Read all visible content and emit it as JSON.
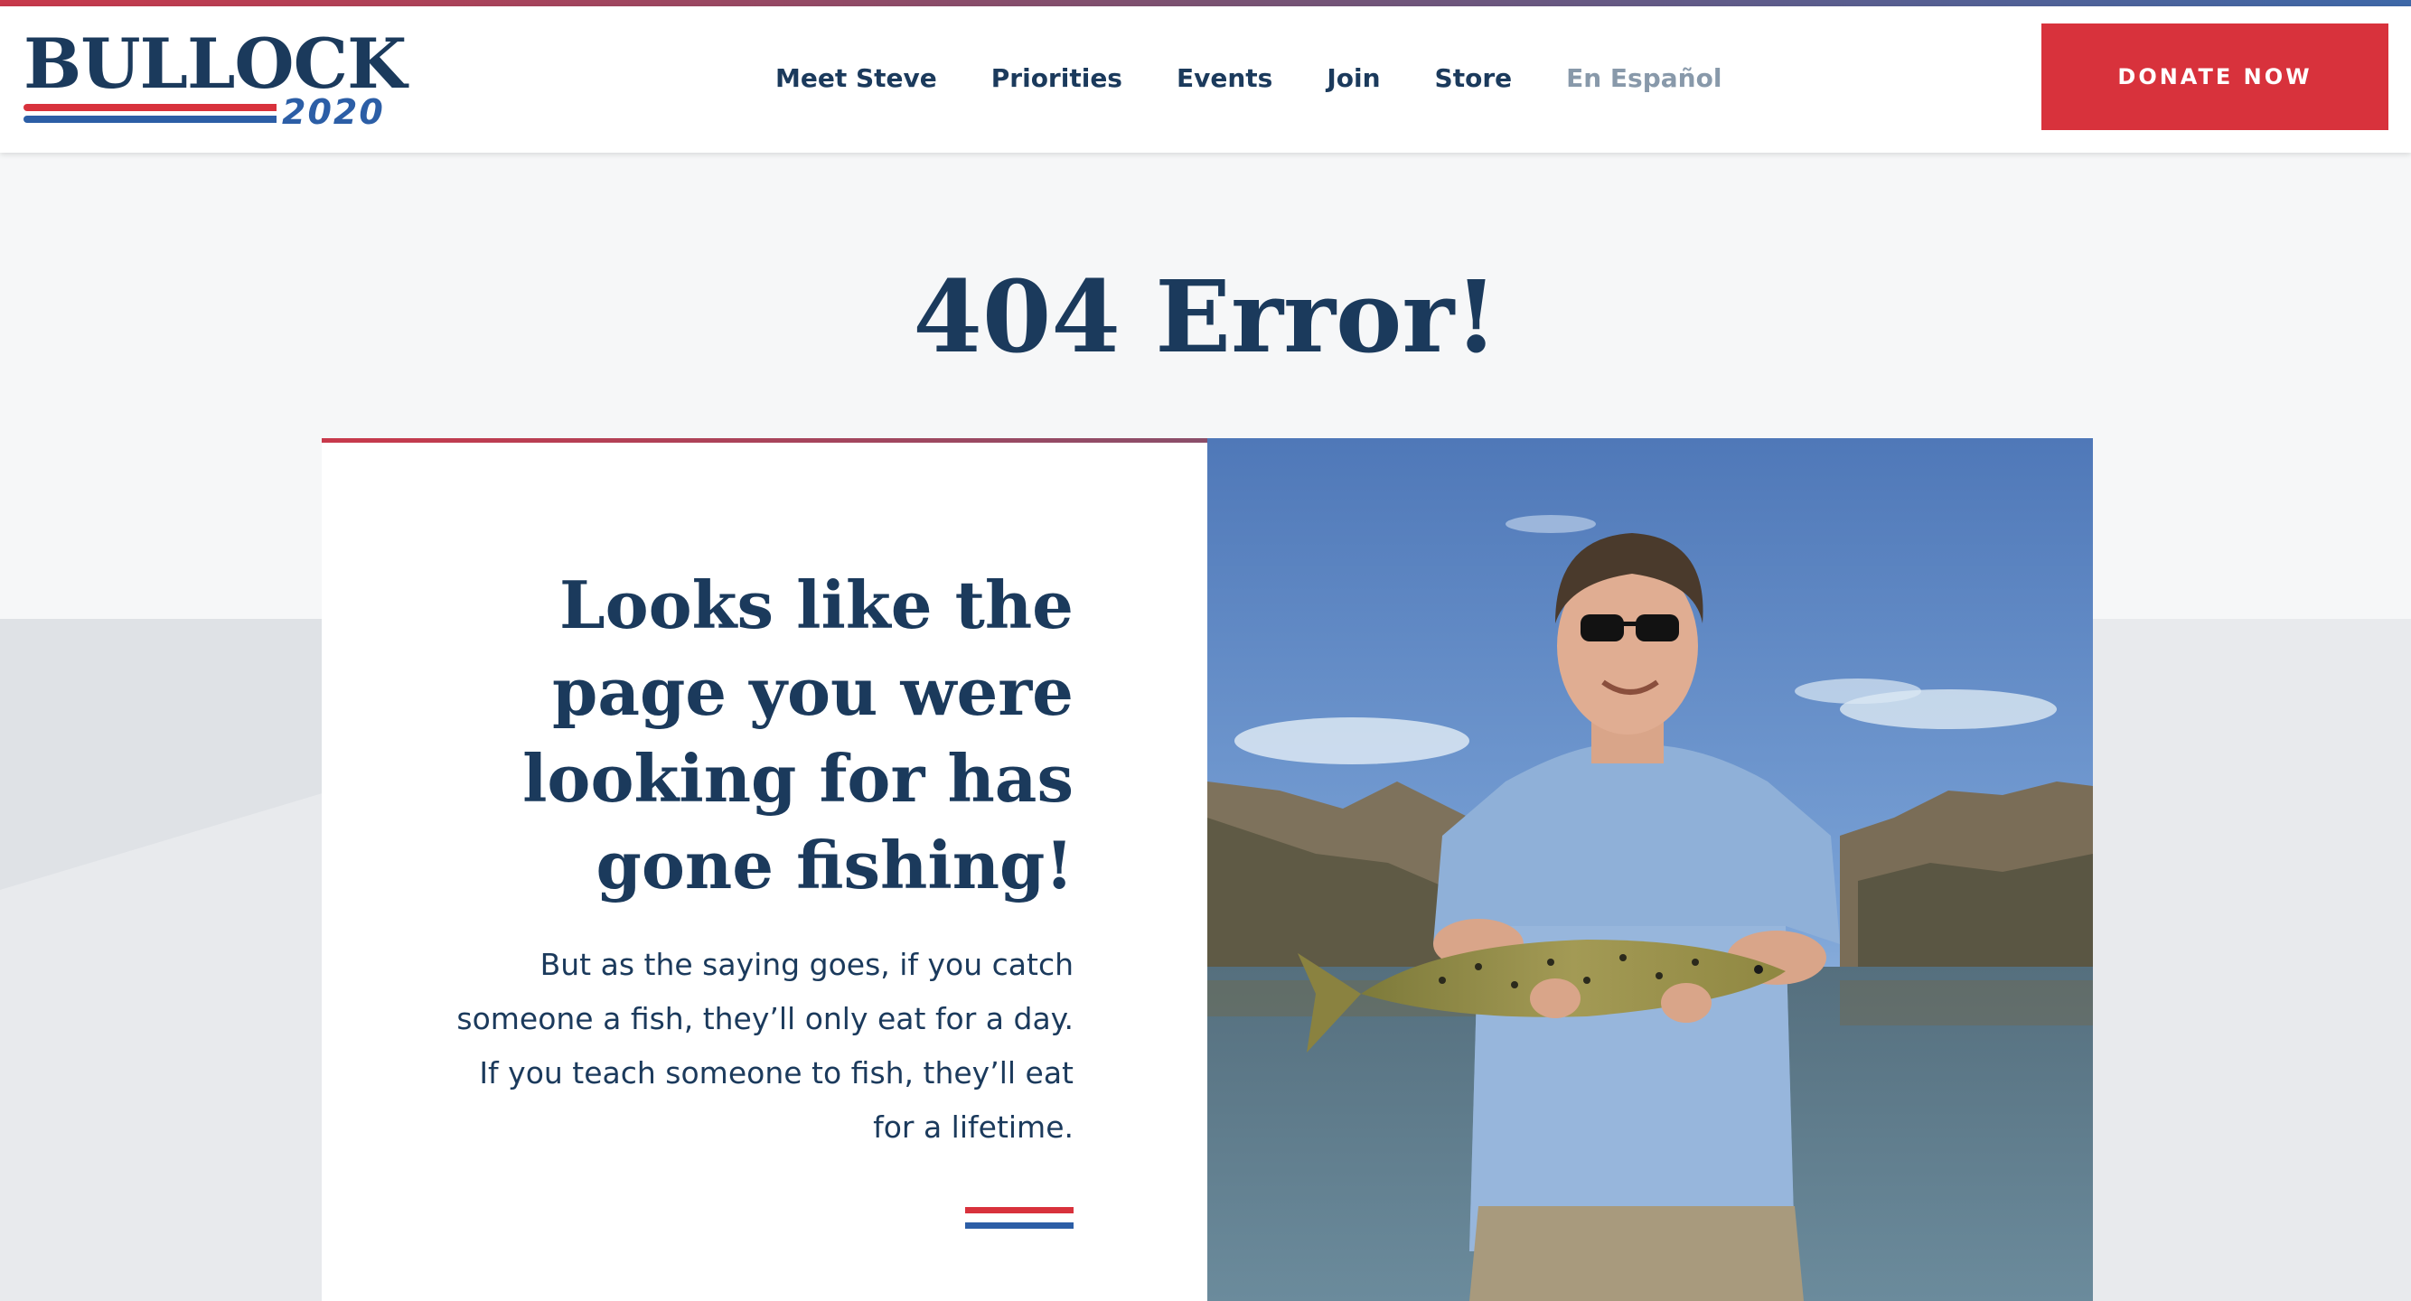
{
  "brand": {
    "name": "BULLOCK",
    "year": "2020"
  },
  "nav": {
    "items": [
      {
        "label": "Meet Steve"
      },
      {
        "label": "Priorities"
      },
      {
        "label": "Events"
      },
      {
        "label": "Join"
      },
      {
        "label": "Store"
      },
      {
        "label": "En Español"
      }
    ]
  },
  "donate": {
    "label": "DONATE NOW"
  },
  "error": {
    "title": "404 Error!",
    "heading": "Looks like the page you were looking for has gone fishing!",
    "body": "But as the saying goes, if you catch someone a fish, they’ll only eat for a day. If you teach someone to fish, they’ll eat for a lifetime."
  },
  "photo": {
    "icon": "man-holding-fish-photo"
  },
  "colors": {
    "navy": "#1b3a5c",
    "red": "#d8323c",
    "blue": "#2c5ea6",
    "muted_nav": "#8899aa"
  }
}
